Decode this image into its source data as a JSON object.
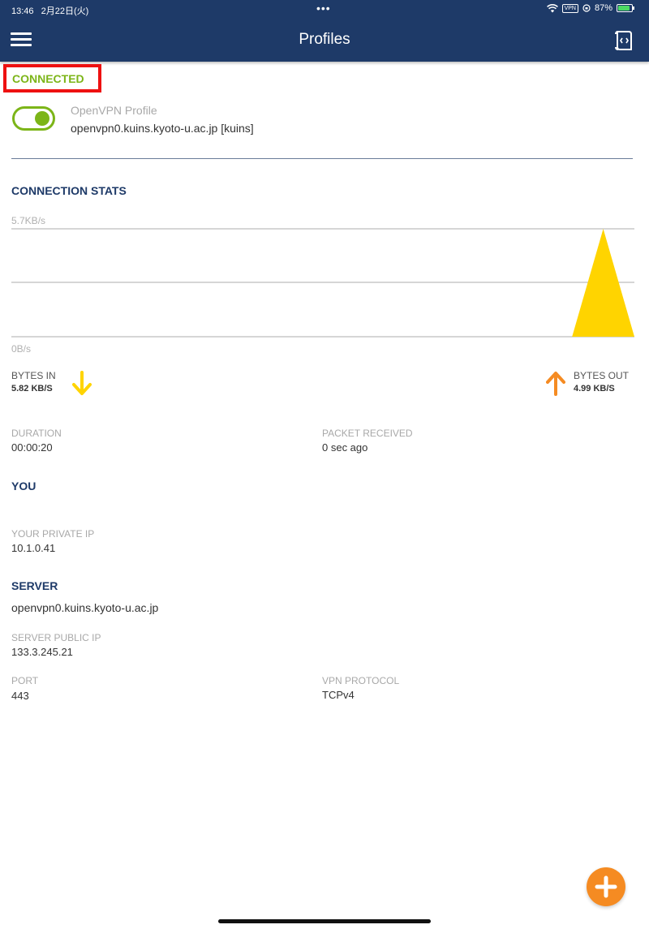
{
  "status_bar": {
    "time": "13:46",
    "date": "2月22日(火)",
    "dots": "•••",
    "vpn": "VPN",
    "battery": "87%",
    "battery_level": 0.87
  },
  "nav": {
    "title": "Profiles"
  },
  "profile": {
    "state": "CONNECTED",
    "type": "OpenVPN Profile",
    "name": "openvpn0.kuins.kyoto-u.ac.jp [kuins]",
    "toggle_on": true
  },
  "stats": {
    "title": "CONNECTION STATS",
    "chart_data": {
      "type": "area",
      "y_max_label": "5.7KB/s",
      "y_min_label": "0B/s",
      "ylim": [
        0,
        5.7
      ],
      "series": [
        {
          "values": [
            0,
            0,
            0,
            0,
            0,
            0,
            0,
            0,
            0,
            0,
            0,
            0,
            0,
            0,
            0,
            0,
            0,
            0,
            0,
            5.7,
            0
          ]
        }
      ],
      "colors": {
        "area": "#ffd400",
        "grid": "#c8c8c8"
      }
    },
    "bytes_in": {
      "label": "BYTES IN",
      "value": "5.82 KB/S",
      "arrow_color": "#ffd400"
    },
    "bytes_out": {
      "label": "BYTES OUT",
      "value": "4.99 KB/S",
      "arrow_color": "#f58b22"
    },
    "duration": {
      "label": "DURATION",
      "value": "00:00:20"
    },
    "packet_received": {
      "label": "PACKET RECEIVED",
      "value": "0 sec ago"
    }
  },
  "you": {
    "title": "YOU",
    "private_ip": {
      "label": "YOUR PRIVATE IP",
      "value": "10.1.0.41"
    }
  },
  "server": {
    "title": "SERVER",
    "hostname": "openvpn0.kuins.kyoto-u.ac.jp",
    "public_ip": {
      "label": "SERVER PUBLIC IP",
      "value": "133.3.245.21"
    },
    "port": {
      "label": "PORT",
      "value": "443"
    },
    "protocol": {
      "label": "VPN PROTOCOL",
      "value": "TCPv4"
    }
  },
  "colors": {
    "header": "#1e3a68",
    "connected": "#7cb518",
    "highlight_box": "#ee1111",
    "fab": "#f58b22"
  }
}
